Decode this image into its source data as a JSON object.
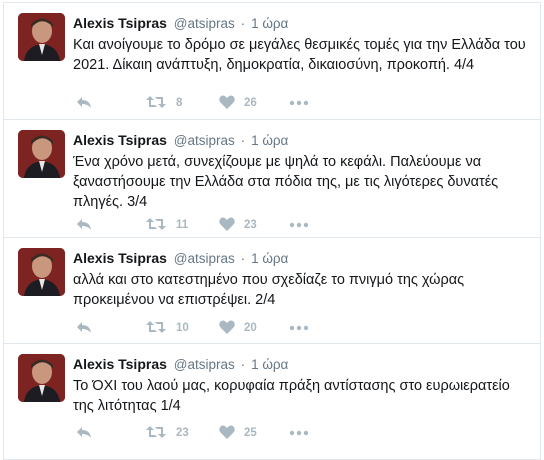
{
  "tweets": [
    {
      "name": "Alexis Tsipras",
      "handle": "@atsipras",
      "separator": "·",
      "time": "1 ώρα",
      "text": "Και ανοίγουμε το δρόμο σε μεγάλες θεσμικές τομές για την Ελλάδα του 2021. Δίκαιη ανάπτυξη, δημοκρατία, δικαιοσύνη, προκοπή. 4/4",
      "retweets": "8",
      "likes": "26"
    },
    {
      "name": "Alexis Tsipras",
      "handle": "@atsipras",
      "separator": "·",
      "time": "1 ώρα",
      "text": "Ένα χρόνο μετά, συνεχίζουμε με ψηλά το κεφάλι. Παλεύουμε να ξαναστήσουμε την Ελλάδα στα πόδια της, με τις λιγότερες δυνατές πληγές. 3/4",
      "retweets": "11",
      "likes": "23"
    },
    {
      "name": "Alexis Tsipras",
      "handle": "@atsipras",
      "separator": "·",
      "time": "1 ώρα",
      "text": "αλλά και στο κατεστημένο που σχεδίαζε το πνιγμό της χώρας προκειμένου να επιστρέψει. 2/4",
      "retweets": "10",
      "likes": "20"
    },
    {
      "name": "Alexis Tsipras",
      "handle": "@atsipras",
      "separator": "·",
      "time": "1 ώρα",
      "text": "Το ΌΧΙ του λαού μας, κορυφαία πράξη αντίστασης στο ευρωιερατείο της λιτότητας 1/4",
      "retweets": "23",
      "likes": "25"
    }
  ],
  "icons": {
    "reply": "reply-icon",
    "retweet": "retweet-icon",
    "like": "heart-icon",
    "more": "more-icon",
    "avatar": "avatar"
  },
  "colors": {
    "name": "#14171a",
    "meta": "#657786",
    "action": "#aab8c2",
    "border": "#e1e8ed"
  }
}
